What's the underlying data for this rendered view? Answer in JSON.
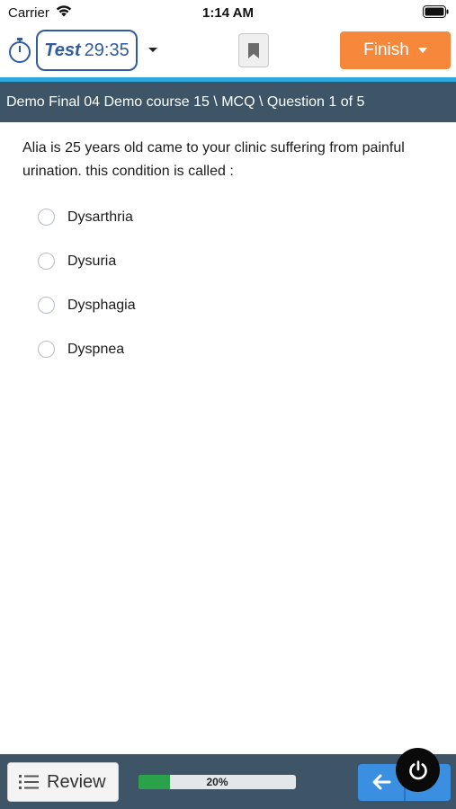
{
  "status_bar": {
    "carrier": "Carrier",
    "time": "1:14 AM"
  },
  "toolbar": {
    "timer_mode": "Test",
    "timer_value": "29:35",
    "finish_label": "Finish"
  },
  "breadcrumb": "Demo Final 04 Demo course 15 \\ MCQ \\ Question 1 of 5",
  "question": {
    "text": "Alia is 25 years old came to your clinic suffering from painful urination. this condition is called :",
    "options": [
      {
        "label": "Dysarthria",
        "selected": false
      },
      {
        "label": "Dysuria",
        "selected": false
      },
      {
        "label": "Dysphagia",
        "selected": false
      },
      {
        "label": "Dyspnea",
        "selected": false
      }
    ]
  },
  "bottom_bar": {
    "review_label": "Review",
    "progress_percent": 20,
    "progress_text": "20%"
  },
  "colors": {
    "accent_orange": "#f5883a",
    "header_slate": "#3d5566",
    "accent_blue": "#2ea6de",
    "timer_blue": "#2e5c9e",
    "progress_green": "#2aa24a",
    "nav_blue": "#3b8fe0"
  },
  "icons": [
    "wifi-icon",
    "battery-icon",
    "timer-icon",
    "caret-down-icon",
    "bookmark-icon",
    "list-icon",
    "back-arrow-icon",
    "power-icon"
  ]
}
